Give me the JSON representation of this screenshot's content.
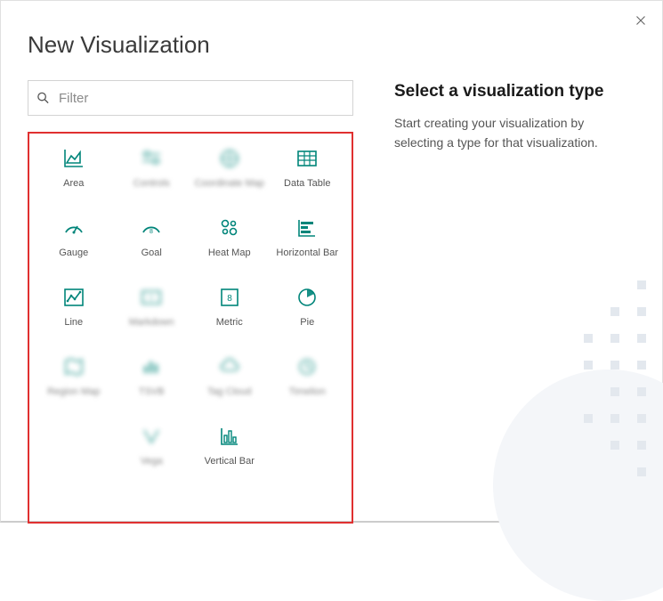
{
  "dialog": {
    "title": "New Visualization",
    "search_placeholder": "Filter"
  },
  "help": {
    "title": "Select a visualization type",
    "description": "Start creating your visualization by selecting a type for that visualization."
  },
  "viz_types": [
    {
      "key": "area",
      "label": "Area",
      "blurred": false
    },
    {
      "key": "controls",
      "label": "Controls",
      "blurred": true
    },
    {
      "key": "coordinate-map",
      "label": "Coordinate Map",
      "blurred": true
    },
    {
      "key": "data-table",
      "label": "Data Table",
      "blurred": false
    },
    {
      "key": "gauge",
      "label": "Gauge",
      "blurred": false
    },
    {
      "key": "goal",
      "label": "Goal",
      "blurred": false
    },
    {
      "key": "heat-map",
      "label": "Heat Map",
      "blurred": false
    },
    {
      "key": "horizontal-bar",
      "label": "Horizontal Bar",
      "blurred": false
    },
    {
      "key": "line",
      "label": "Line",
      "blurred": false
    },
    {
      "key": "markdown",
      "label": "Markdown",
      "blurred": true
    },
    {
      "key": "metric",
      "label": "Metric",
      "blurred": false
    },
    {
      "key": "pie",
      "label": "Pie",
      "blurred": false
    },
    {
      "key": "region-map",
      "label": "Region Map",
      "blurred": true
    },
    {
      "key": "tsvb",
      "label": "TSVB",
      "blurred": true
    },
    {
      "key": "tag-cloud",
      "label": "Tag Cloud",
      "blurred": true
    },
    {
      "key": "timelion",
      "label": "Timelion",
      "blurred": true
    },
    {
      "key": "vega",
      "label": "Vega",
      "blurred": true
    },
    {
      "key": "vertical-bar",
      "label": "Vertical Bar",
      "blurred": false
    }
  ]
}
